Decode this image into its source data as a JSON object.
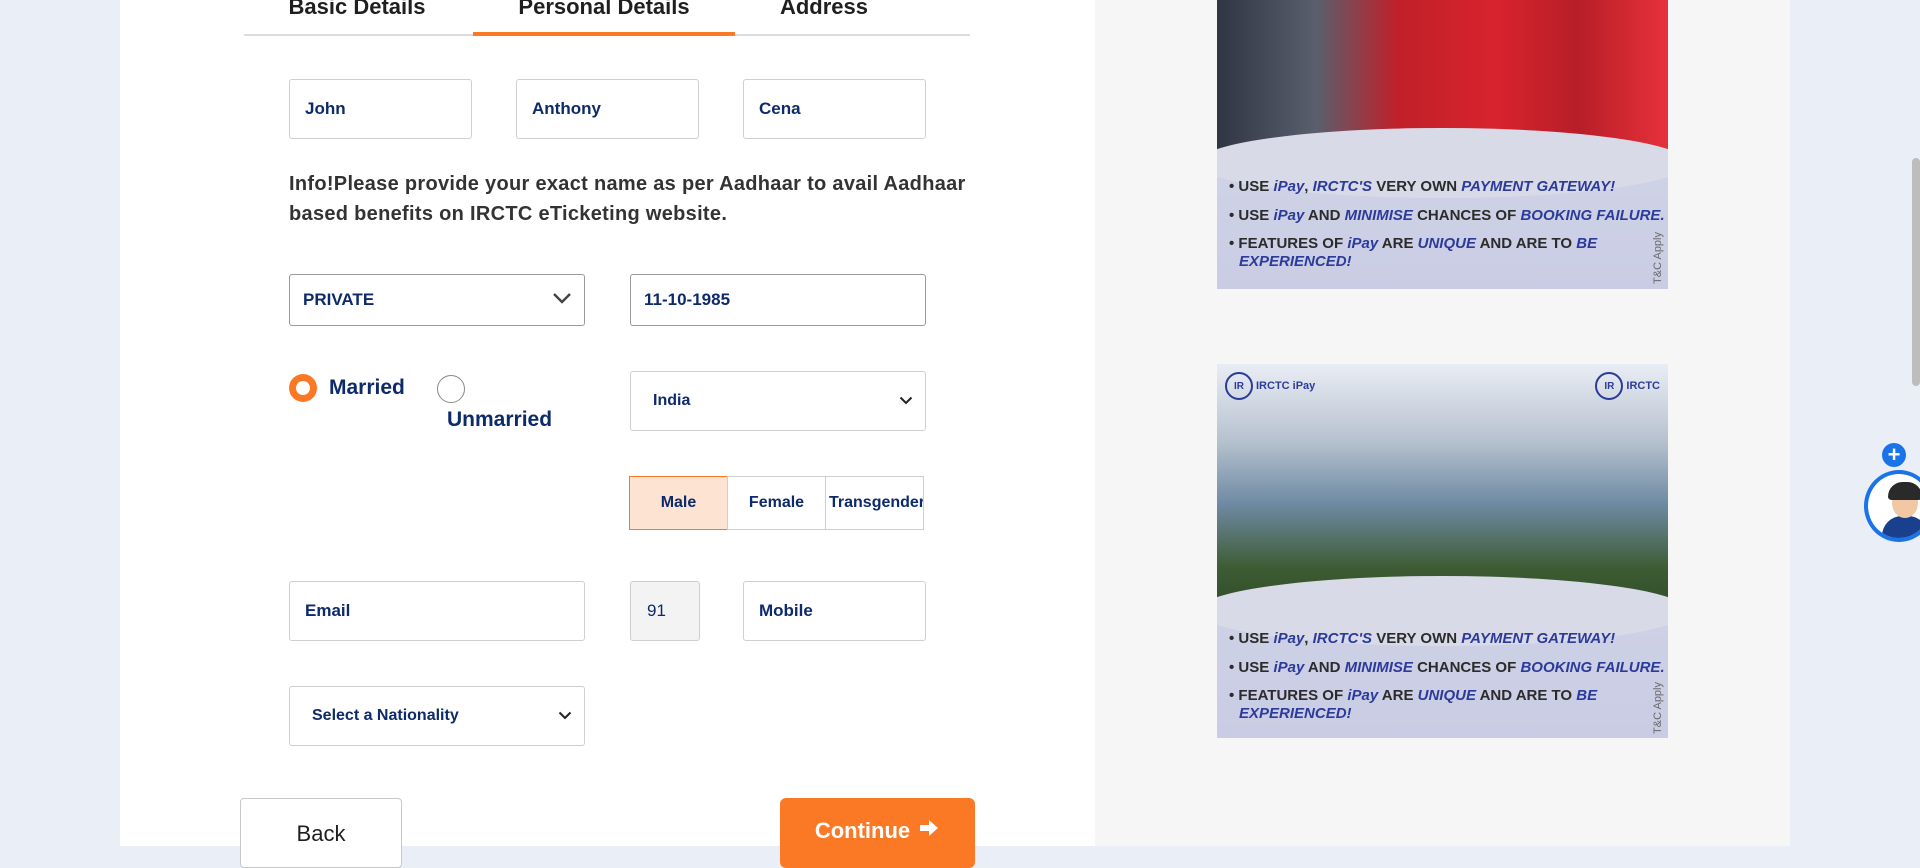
{
  "tabs": [
    {
      "label": "Basic Details",
      "active": false
    },
    {
      "label": "Personal Details",
      "active": true
    },
    {
      "label": "Address",
      "active": false
    }
  ],
  "name": {
    "first": "John",
    "middle": "Anthony",
    "last": "Cena"
  },
  "info_text": "Info!Please provide your exact name as per Aadhaar to avail Aadhaar based benefits on IRCTC eTicketing website.",
  "occupation": {
    "selected": "PRIVATE"
  },
  "dob": {
    "value": "11-10-1985"
  },
  "marital": {
    "married_label": "Married",
    "unmarried_label": "Unmarried",
    "selected": "Married"
  },
  "country": {
    "selected": "India"
  },
  "gender": {
    "options": [
      "Male",
      "Female",
      "Transgender"
    ],
    "selected": "Male"
  },
  "contact": {
    "email_placeholder": "Email",
    "isd": "91",
    "mobile_placeholder": "Mobile"
  },
  "nationality": {
    "placeholder": "Select a Nationality"
  },
  "buttons": {
    "back": "Back",
    "continue": "Continue"
  },
  "ad1": {
    "lines": [
      {
        "pre": "• USE ",
        "em1": "iPay",
        "mid": ", ",
        "em2": "IRCTC'S",
        "post": " VERY OWN ",
        "em3": "PAYMENT GATEWAY!"
      },
      {
        "pre": "• USE ",
        "em1": "iPay",
        "mid": " AND ",
        "em2": "MINIMISE",
        "post": " CHANCES OF ",
        "em3": "BOOKING FAILURE."
      }
    ],
    "line3a": "• FEATURES OF ",
    "line3b": "iPay",
    "line3c": " ARE ",
    "line3d": "UNIQUE",
    "line3e": " AND ARE TO ",
    "line3f": "BE",
    "line4": "EXPERIENCED!",
    "tc": "T&C Apply"
  },
  "ad2": {
    "logo_left": "IRCTC iPay",
    "logo_right": "IRCTC",
    "lines": [
      {
        "pre": "• USE ",
        "em1": "iPay",
        "mid": ", ",
        "em2": "IRCTC'S",
        "post": " VERY OWN ",
        "em3": "PAYMENT GATEWAY!"
      },
      {
        "pre": "• USE ",
        "em1": "iPay",
        "mid": " AND ",
        "em2": "MINIMISE",
        "post": " CHANCES OF ",
        "em3": "BOOKING FAILURE."
      }
    ],
    "line3a": "• FEATURES OF ",
    "line3b": "iPay",
    "line3c": " ARE ",
    "line3d": "UNIQUE",
    "line3e": " AND ARE TO ",
    "line3f": "BE",
    "line4": "EXPERIENCED!",
    "tc": "T&C Apply"
  },
  "colors": {
    "accent": "#fb7925",
    "text_primary": "#0d2a6b",
    "fab": "#1a73e8"
  },
  "icons": [
    "chevron-down-icon",
    "arrow-right-icon",
    "plus-icon",
    "askdisha-avatar"
  ]
}
